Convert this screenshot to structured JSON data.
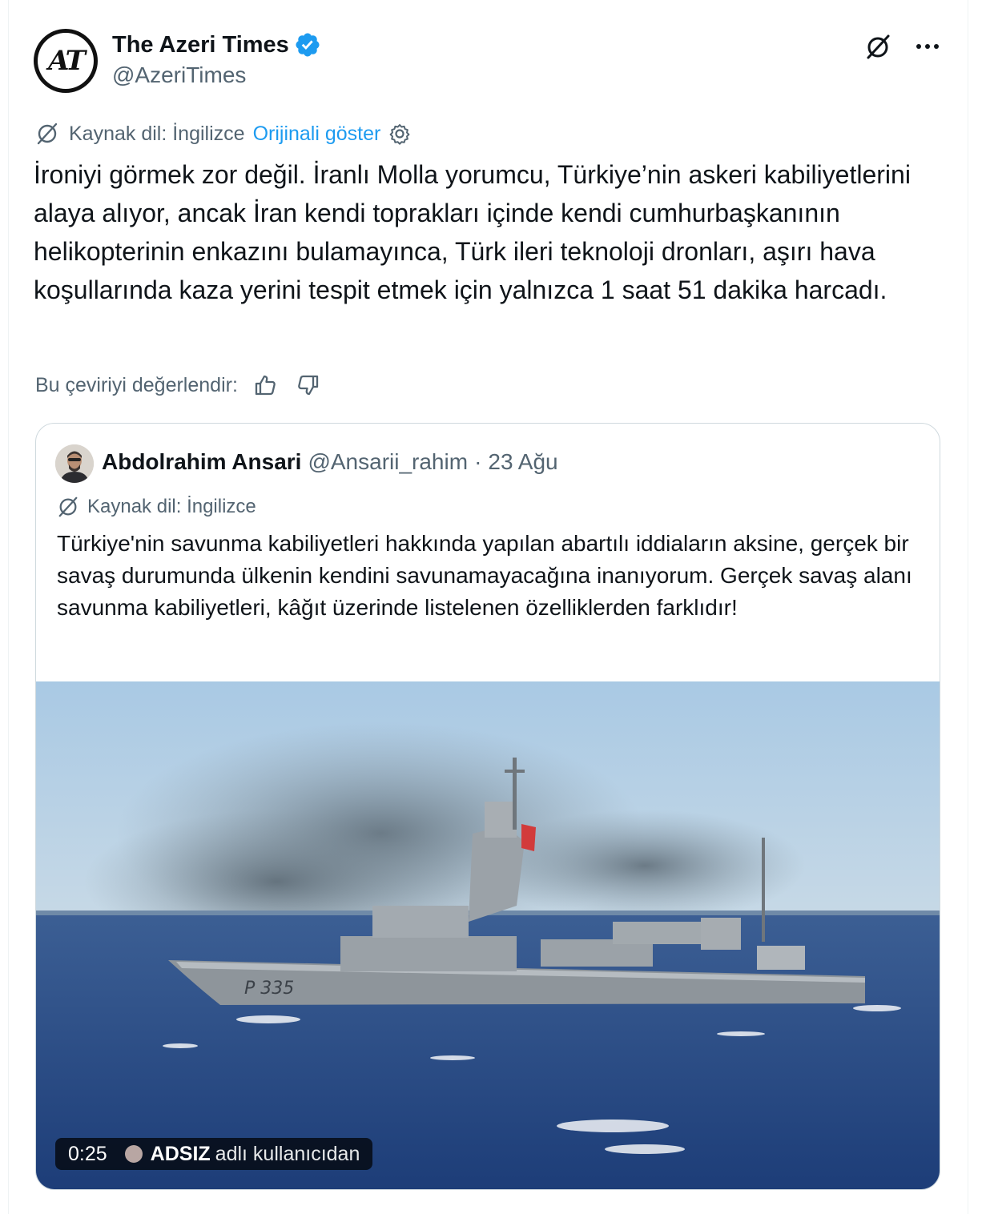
{
  "author": {
    "display_name": "The Azeri Times",
    "handle": "@AzeriTimes",
    "avatar_monogram": "AT",
    "verified": true
  },
  "icons": {
    "top_right": [
      "grok-icon",
      "more-icon"
    ],
    "translate": "translate-icon",
    "settings": "gear-icon",
    "rate": [
      "thumbs-up-icon",
      "thumbs-down-icon"
    ]
  },
  "translation": {
    "source_label": "Kaynak dil: İngilizce",
    "show_original": "Orijinali göster"
  },
  "tweet_text": "İroniyi görmek zor değil. İranlı Molla yorumcu, Türkiye’nin askeri kabiliyetlerini alaya alıyor, ancak İran kendi toprakları içinde kendi cumhurbaşkanının helikopterinin enkazını bulamayınca, Türk ileri teknoloji dronları, aşırı hava koşullarında kaza yerini tespit etmek için yalnızca 1 saat 51 dakika harcadı.",
  "rate_label": "Bu çeviriyi değerlendir:",
  "quote": {
    "display_name": "Abdolrahim Ansari",
    "handle": "@Ansarii_rahim",
    "separator": "·",
    "date": "23 Ağu",
    "source_label": "Kaynak dil: İngilizce",
    "text": "Türkiye'nin savunma kabiliyetleri hakkında yapılan abartılı iddiaların aksine, gerçek bir savaş durumunda ülkenin kendini savunamayacağına inanıyorum. Gerçek savaş alanı savunma kabiliyetleri, kâğıt üzerinde listelenen özelliklerden farklıdır!",
    "media": {
      "ship_hull_number": "P 335",
      "video_duration": "0:25",
      "attribution_user": "ADSIZ",
      "attribution_suffix": "adlı kullanıcıdan"
    }
  },
  "colors": {
    "accent": "#1d9bf0",
    "secondary_text": "#536471",
    "primary_text": "#0f1419",
    "border": "#cfd9de"
  }
}
